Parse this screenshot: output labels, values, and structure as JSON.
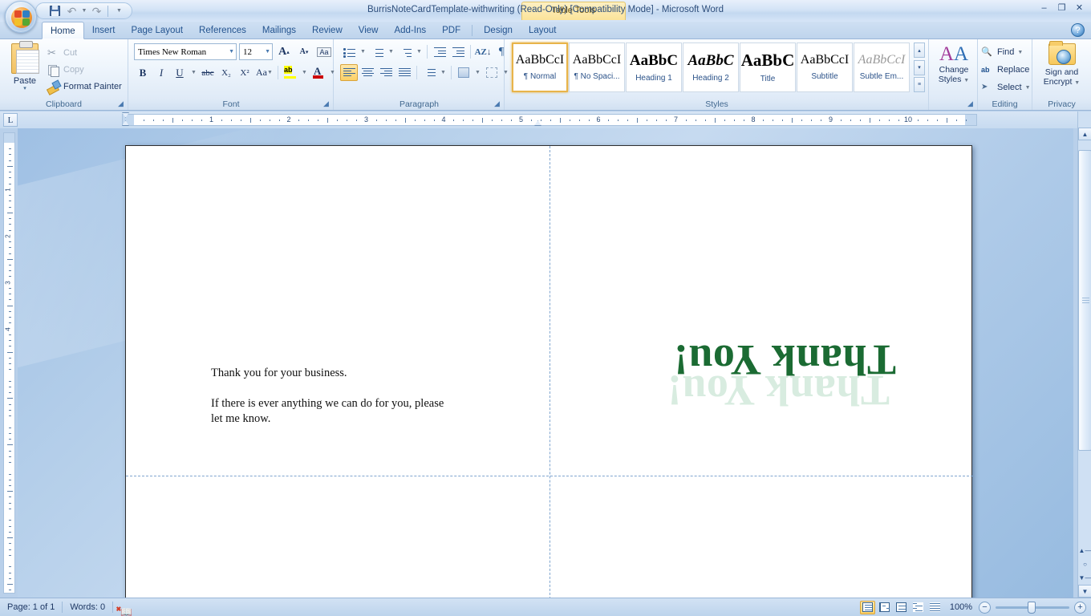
{
  "window": {
    "title": "BurrisNoteCardTemplate-withwriting (Read-Only) [Compatibility Mode] - Microsoft Word",
    "contextual_tab_group": "Table Tools",
    "minimize": "–",
    "restore": "❐",
    "close": "✕",
    "help": "?"
  },
  "quick_access": {
    "save": "save-icon",
    "undo": "↶",
    "redo": "↷",
    "customize": "─"
  },
  "tabs": [
    {
      "label": "Home",
      "active": true
    },
    {
      "label": "Insert",
      "active": false
    },
    {
      "label": "Page Layout",
      "active": false
    },
    {
      "label": "References",
      "active": false
    },
    {
      "label": "Mailings",
      "active": false
    },
    {
      "label": "Review",
      "active": false
    },
    {
      "label": "View",
      "active": false
    },
    {
      "label": "Add-Ins",
      "active": false
    },
    {
      "label": "PDF",
      "active": false
    },
    {
      "label": "Design",
      "active": false,
      "contextual": true
    },
    {
      "label": "Layout",
      "active": false,
      "contextual": true
    }
  ],
  "ribbon": {
    "clipboard": {
      "group_label": "Clipboard",
      "paste_label": "Paste",
      "paste_arrow": "▾",
      "items": [
        {
          "label": "Cut",
          "icon": "scissors-icon",
          "disabled": true
        },
        {
          "label": "Copy",
          "icon": "copy-icon",
          "disabled": true
        },
        {
          "label": "Format Painter",
          "icon": "format-painter-icon",
          "disabled": false
        }
      ]
    },
    "font": {
      "group_label": "Font",
      "font_name": "Times New Roman",
      "font_size": "12",
      "grow_font": "A",
      "shrink_font": "A",
      "clear_formatting": "Aa",
      "bold": "B",
      "italic": "I",
      "underline": "U",
      "strikethrough": "abc",
      "subscript": "X₂",
      "superscript": "X²",
      "change_case": "Aa",
      "highlight": "ab",
      "font_color": "A",
      "font_color_hex": "#cc0000"
    },
    "paragraph": {
      "group_label": "Paragraph",
      "bullets": "bullets-icon",
      "numbering": "numbering-icon",
      "multilevel": "multilevel-list-icon",
      "decrease_indent": "decrease-indent-icon",
      "increase_indent": "increase-indent-icon",
      "sort": "AZ",
      "show_marks": "¶",
      "align_left": "align-left-icon",
      "align_center": "align-center-icon",
      "align_right": "align-right-icon",
      "justify": "justify-icon",
      "line_spacing": "line-spacing-icon",
      "shading": "shading-icon",
      "borders": "borders-icon"
    },
    "styles": {
      "group_label": "Styles",
      "gallery": [
        {
          "sample": "AaBbCcI",
          "name": "¶ Normal",
          "selected": true,
          "style": "normal"
        },
        {
          "sample": "AaBbCcI",
          "name": "¶ No Spaci...",
          "selected": false,
          "style": "normal"
        },
        {
          "sample": "AaBbC",
          "name": "Heading 1",
          "selected": false,
          "style": "bold"
        },
        {
          "sample": "AaBbC",
          "name": "Heading 2",
          "selected": false,
          "style": "bolditalic"
        },
        {
          "sample": "AaBbC",
          "name": "Title",
          "selected": false,
          "style": "bigbold"
        },
        {
          "sample": "AaBbCcI",
          "name": "Subtitle",
          "selected": false,
          "style": "normal"
        },
        {
          "sample": "AaBbCcI",
          "name": "Subtle Em...",
          "selected": false,
          "style": "grayitalic"
        }
      ],
      "scroll_up": "▴",
      "scroll_down": "▾",
      "more": "≡"
    },
    "change_styles": {
      "label_line1": "Change",
      "label_line2": "Styles",
      "arrow": "▾"
    },
    "editing": {
      "group_label": "Editing",
      "items": [
        {
          "label": "Find",
          "icon": "find-icon",
          "arrow": "▾"
        },
        {
          "label": "Replace",
          "icon": "replace-icon",
          "arrow": ""
        },
        {
          "label": "Select",
          "icon": "select-icon",
          "arrow": "▾"
        }
      ]
    },
    "privacy": {
      "group_label": "Privacy",
      "label_line1": "Sign and",
      "label_line2": "Encrypt",
      "arrow": "▾"
    }
  },
  "ruler": {
    "tab_selector": "L",
    "horizontal_numbers": [
      "1",
      "2",
      "3",
      "4",
      "5",
      "6",
      "7",
      "8",
      "9",
      "10"
    ],
    "vertical_numbers": [
      "1",
      "2",
      "3",
      "4"
    ],
    "unit": "inches"
  },
  "document": {
    "card_front_heading": "Thank You!",
    "card_inside_line1": "Thank you for your business.",
    "card_inside_line2": "If there is ever anything we can do for you, please",
    "card_inside_line3": "let me know.",
    "heading_color": "#1b6b33",
    "heading_shadow_color": "#d8ece0"
  },
  "status_bar": {
    "page": "Page: 1 of 1",
    "words": "Words: 0",
    "proofing": "proofing-errors-icon",
    "views": [
      {
        "name": "print-layout",
        "selected": true
      },
      {
        "name": "full-screen-reading",
        "selected": false
      },
      {
        "name": "web-layout",
        "selected": false
      },
      {
        "name": "outline",
        "selected": false
      },
      {
        "name": "draft",
        "selected": false
      }
    ],
    "zoom": "100%",
    "zoom_out": "−",
    "zoom_in": "+"
  }
}
